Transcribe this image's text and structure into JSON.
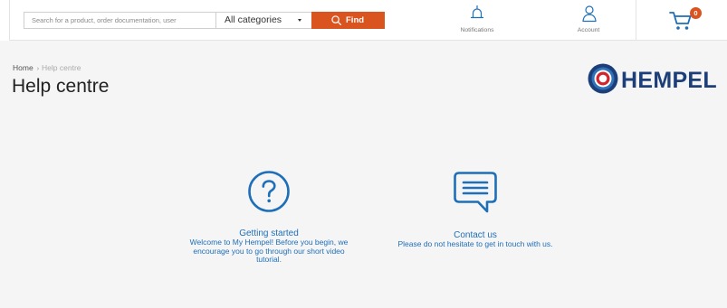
{
  "header": {
    "search_placeholder": "Search for a product, order documentation, user",
    "category_selected": "All categories",
    "find_label": "Find",
    "notifications_label": "Notifications",
    "account_label": "Account",
    "cart_count": "0"
  },
  "breadcrumb": {
    "home": "Home",
    "separator": "›",
    "current": "Help centre"
  },
  "page_title": "Help centre",
  "logo": {
    "text": "HEMPEL"
  },
  "cards": {
    "getting_started": {
      "title": "Getting started",
      "description": "Welcome to My Hempel! Before you begin, we encourage you to go through our short video tutorial."
    },
    "contact_us": {
      "title": "Contact us",
      "description": "Please do not hesitate to get in touch with us."
    }
  },
  "colors": {
    "accent": "#d9541f",
    "link_blue": "#1e6fb8",
    "brand_navy": "#1c3f7a",
    "brand_red": "#d3262c"
  },
  "icons": {
    "find": "search-icon",
    "notifications": "bell-icon",
    "account": "user-icon",
    "cart": "cart-icon",
    "getting_started": "question-circle-icon",
    "contact_us": "chat-bubble-icon"
  }
}
